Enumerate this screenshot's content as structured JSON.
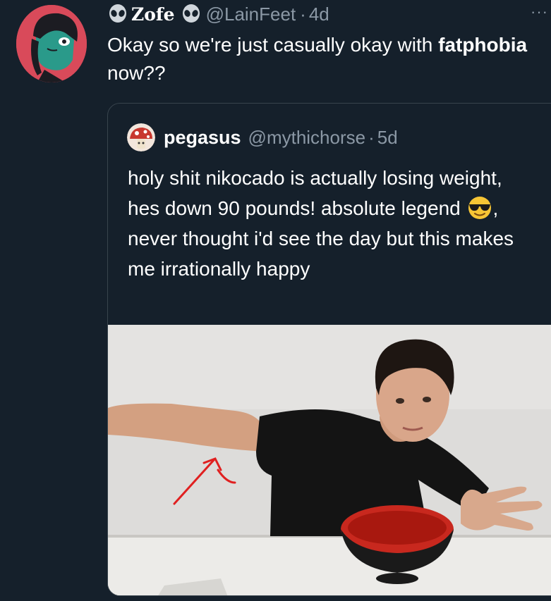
{
  "tweet": {
    "display_name": "Zofe",
    "handle": "@LainFeet",
    "separator": "·",
    "time": "4d",
    "more": "···",
    "text_part1": "Okay so we're just casually okay with ",
    "text_bold": "fatphobia",
    "text_part2": " now??"
  },
  "quote": {
    "display_name": "pegasus",
    "handle": "@mythichorse",
    "separator": "·",
    "time": "5d",
    "text_part1": "holy shit nikocado is actually losing weight, hes down 90 pounds! absolute legend ",
    "emoji": "😎",
    "text_part2": ", never thought i'd see the day but this makes me irrationally happy"
  },
  "colors": {
    "background": "#15202b",
    "secondary_text": "#8b98a5",
    "border": "#38444d",
    "avatar_bg": "#d94a5a",
    "arrow": "#e02020"
  },
  "icons": {
    "name_emoji_left": "alien-icon",
    "name_emoji_right": "alien-icon",
    "more": "more-icon"
  }
}
